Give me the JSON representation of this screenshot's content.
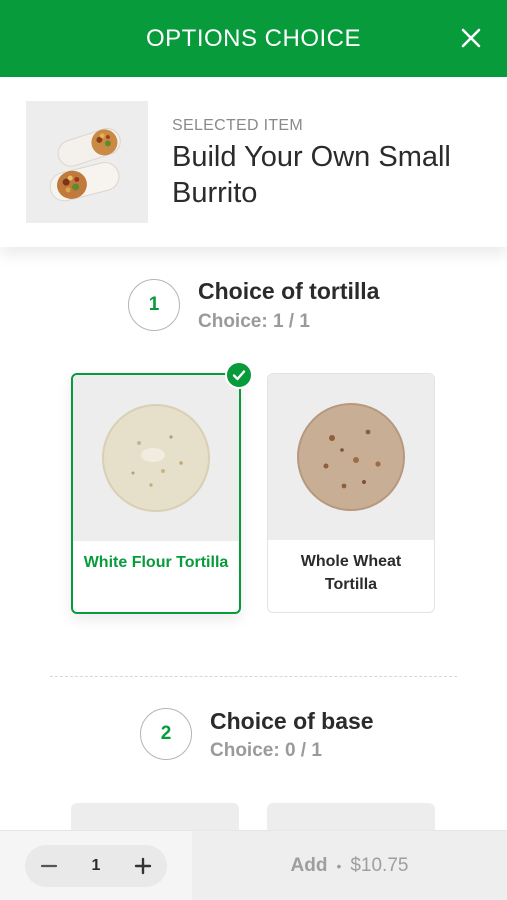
{
  "header": {
    "title": "OPTIONS CHOICE"
  },
  "selected_item": {
    "label": "SELECTED ITEM",
    "name": "Build Your Own Small Burrito"
  },
  "sections": [
    {
      "number": "1",
      "title": "Choice of tortilla",
      "choice": "Choice: 1 / 1",
      "options": [
        {
          "label": "White Flour Tortilla",
          "selected": true
        },
        {
          "label": "Whole Wheat Tortilla",
          "selected": false
        }
      ]
    },
    {
      "number": "2",
      "title": "Choice of base",
      "choice": "Choice: 0 / 1"
    }
  ],
  "footer": {
    "quantity": "1",
    "add_label": "Add",
    "separator": "•",
    "price": "$10.75"
  },
  "colors": {
    "brand_green": "#079b3c",
    "muted_gray": "#9a9a9a"
  },
  "icons": [
    "close-icon",
    "check-icon",
    "minus-icon",
    "plus-icon"
  ]
}
